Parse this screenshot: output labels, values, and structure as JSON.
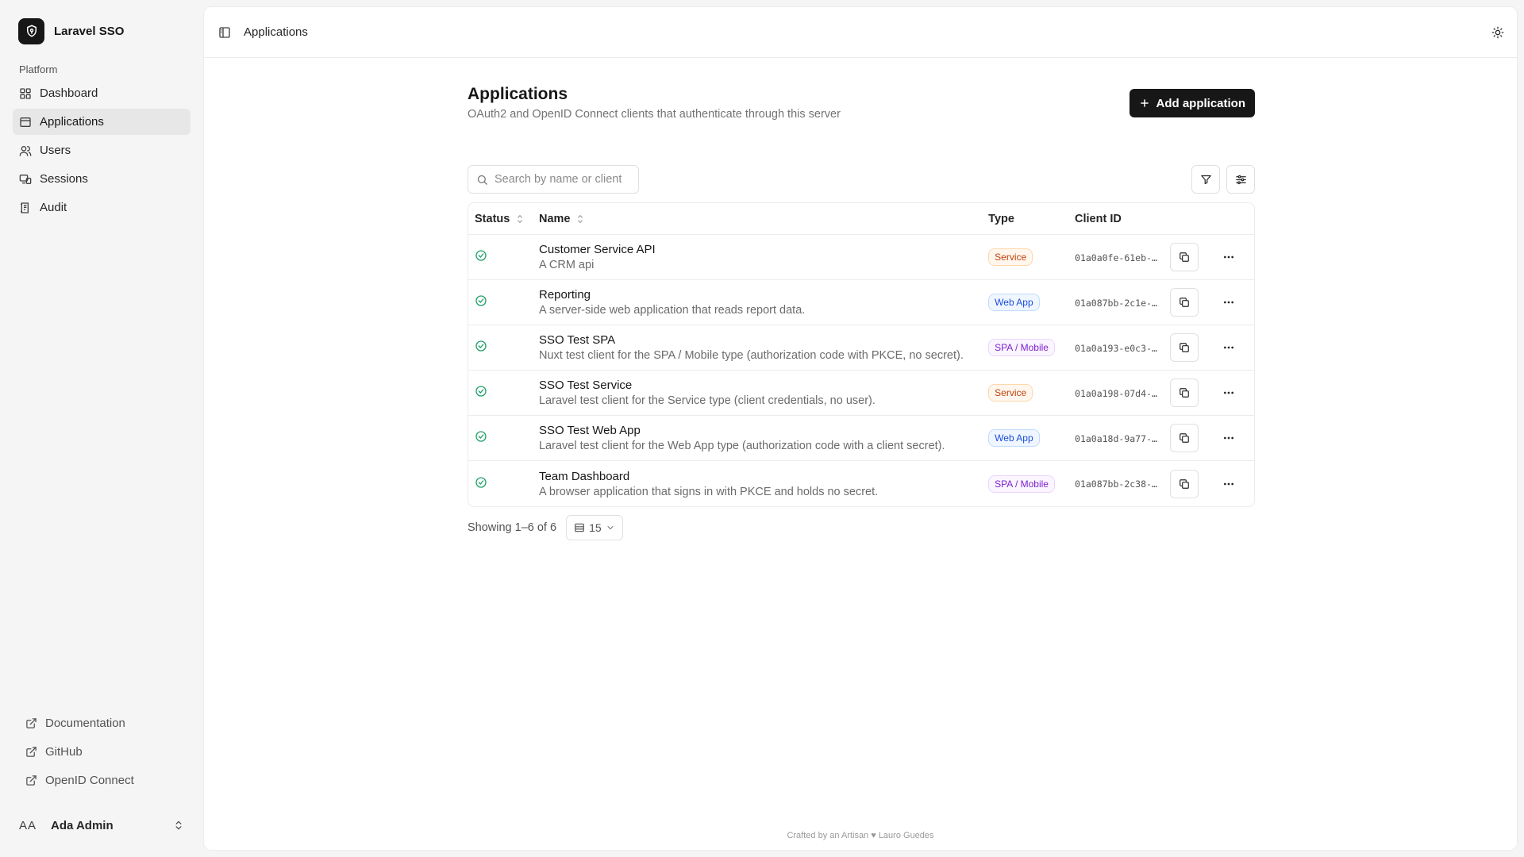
{
  "app": {
    "name": "Laravel SSO"
  },
  "sidebar": {
    "group_label": "Platform",
    "items": [
      {
        "label": "Dashboard",
        "icon": "grid-icon"
      },
      {
        "label": "Applications",
        "icon": "app-window-icon"
      },
      {
        "label": "Users",
        "icon": "users-icon"
      },
      {
        "label": "Sessions",
        "icon": "monitor-icon"
      },
      {
        "label": "Audit",
        "icon": "audit-log-icon"
      }
    ],
    "active": "Applications",
    "footer_links": [
      "Documentation",
      "GitHub",
      "OpenID Connect"
    ],
    "user": {
      "initials": "AA",
      "name": "Ada Admin"
    }
  },
  "topbar": {
    "breadcrumb": "Applications"
  },
  "page": {
    "title": "Applications",
    "subtitle": "OAuth2 and OpenID Connect clients that authenticate through this server",
    "add_button": "Add application"
  },
  "search": {
    "placeholder": "Search by name or client ID",
    "value": ""
  },
  "table": {
    "columns": [
      "Status",
      "Name",
      "Type",
      "Client ID"
    ],
    "rows": [
      {
        "status": "active",
        "name": "Customer Service API",
        "description": "A CRM api",
        "type": "Service",
        "client_id": "01a0a0fe-61eb-…"
      },
      {
        "status": "active",
        "name": "Reporting",
        "description": "A server-side web application that reads report data.",
        "type": "Web App",
        "client_id": "01a087bb-2c1e-…"
      },
      {
        "status": "active",
        "name": "SSO Test SPA",
        "description": "Nuxt test client for the SPA / Mobile type (authorization code with PKCE, no secret).",
        "type": "SPA / Mobile",
        "client_id": "01a0a193-e0c3-…"
      },
      {
        "status": "active",
        "name": "SSO Test Service",
        "description": "Laravel test client for the Service type (client credentials, no user).",
        "type": "Service",
        "client_id": "01a0a198-07d4-…"
      },
      {
        "status": "active",
        "name": "SSO Test Web App",
        "description": "Laravel test client for the Web App type (authorization code with a client secret).",
        "type": "Web App",
        "client_id": "01a0a18d-9a77-…"
      },
      {
        "status": "active",
        "name": "Team Dashboard",
        "description": "A browser application that signs in with PKCE and holds no secret.",
        "type": "SPA / Mobile",
        "client_id": "01a087bb-2c38-…"
      }
    ]
  },
  "pagination": {
    "summary": "Showing 1–6 of 6",
    "per_page": "15"
  },
  "footer": {
    "credit": "Crafted by an Artisan ♥ Lauro Guedes"
  },
  "colors": {
    "primary": "#171717",
    "status_ok": "#22a06b",
    "sidebar_bg": "#f5f5f5"
  }
}
